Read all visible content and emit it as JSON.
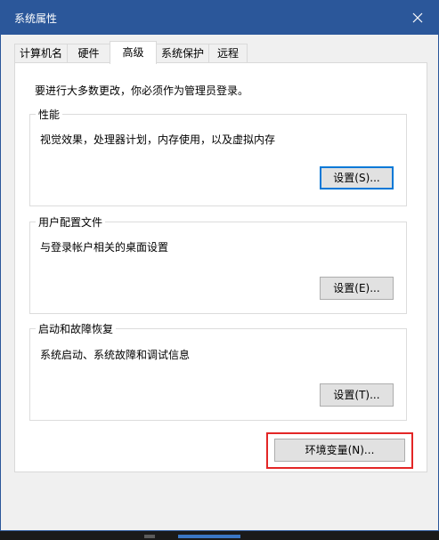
{
  "window": {
    "title": "系统属性"
  },
  "tabs": [
    {
      "label": "计算机名"
    },
    {
      "label": "硬件"
    },
    {
      "label": "高级"
    },
    {
      "label": "系统保护"
    },
    {
      "label": "远程"
    }
  ],
  "admin_note": "要进行大多数更改，你必须作为管理员登录。",
  "performance": {
    "title": "性能",
    "description": "视觉效果，处理器计划，内存使用，以及虚拟内存",
    "button": "设置(S)..."
  },
  "user_profiles": {
    "title": "用户配置文件",
    "description": "与登录帐户相关的桌面设置",
    "button": "设置(E)..."
  },
  "startup_recovery": {
    "title": "启动和故障恢复",
    "description": "系统启动、系统故障和调试信息",
    "button": "设置(T)..."
  },
  "env_button": "环境变量(N)...",
  "colors": {
    "titlebar": "#2b579a",
    "highlight": "#e32626",
    "focus": "#0078d7"
  },
  "icons": {
    "close": "close-icon"
  }
}
